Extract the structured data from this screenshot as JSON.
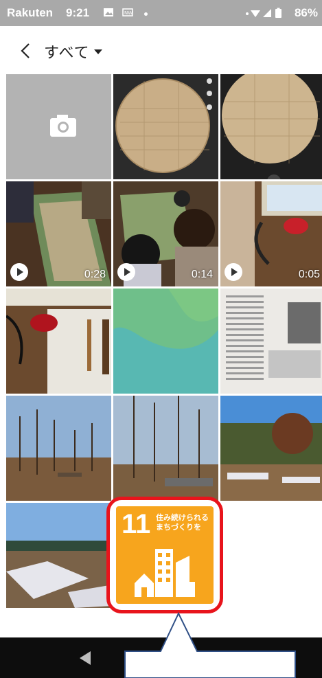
{
  "status_bar": {
    "carrier": "Rakuten",
    "time": "9:21",
    "battery": "86%"
  },
  "header": {
    "title": "すべて"
  },
  "tiles": [
    {
      "kind": "camera"
    },
    {
      "kind": "photo",
      "desc": "paper-circle"
    },
    {
      "kind": "photo",
      "desc": "paper-circle-2"
    },
    {
      "kind": "video",
      "duration": "0:28"
    },
    {
      "kind": "video",
      "duration": "0:14"
    },
    {
      "kind": "video",
      "duration": "0:05"
    },
    {
      "kind": "photo",
      "desc": "desk-mouse"
    },
    {
      "kind": "photo",
      "desc": "teal-abstract"
    },
    {
      "kind": "photo",
      "desc": "newspaper"
    },
    {
      "kind": "photo",
      "desc": "trees-1"
    },
    {
      "kind": "photo",
      "desc": "trees-2"
    },
    {
      "kind": "photo",
      "desc": "trees-3"
    },
    {
      "kind": "photo",
      "desc": "landscape-snow"
    }
  ],
  "sdg": {
    "number": "11",
    "line1": "住み続けられる",
    "line2": "まちづくりを",
    "color": "#f7a51d"
  },
  "highlight_color": "#e8141c"
}
